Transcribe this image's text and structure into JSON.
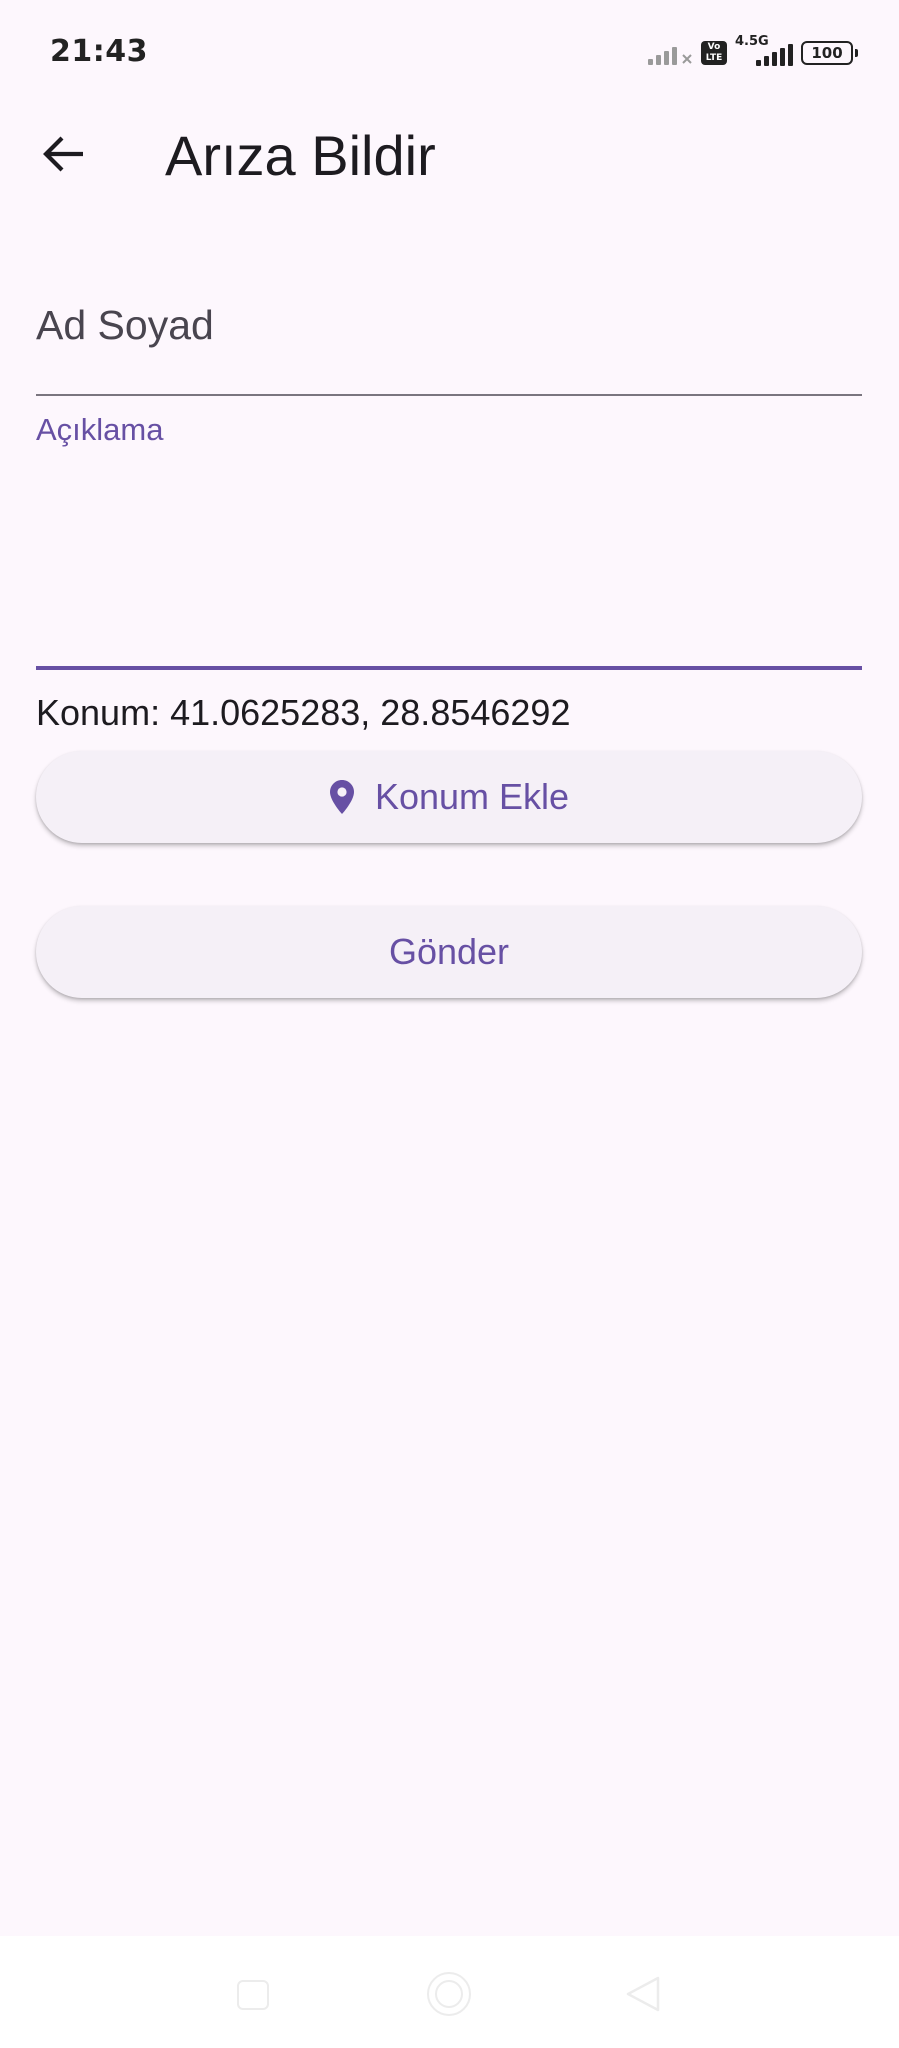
{
  "status_bar": {
    "time": "21:43",
    "network_type": "4.5G",
    "volte_label": "Vo LTE",
    "battery": "100"
  },
  "app_bar": {
    "title": "Arıza Bildir",
    "back_icon": "arrow-back-icon"
  },
  "form": {
    "name_placeholder": "Ad Soyad",
    "name_value": "",
    "description_label": "Açıklama",
    "description_value": "",
    "location_text": "Konum: 41.0625283, 28.8546292",
    "add_location_label": "Konum Ekle",
    "add_location_icon": "location-pin-icon",
    "submit_label": "Gönder"
  },
  "colors": {
    "background": "#fdf7fd",
    "accent": "#6750a4",
    "button_surface": "#f5f0f7",
    "text": "#1d1b20"
  },
  "nav_bar": {
    "icons": [
      "recent-apps-icon",
      "home-icon",
      "back-nav-icon"
    ]
  }
}
